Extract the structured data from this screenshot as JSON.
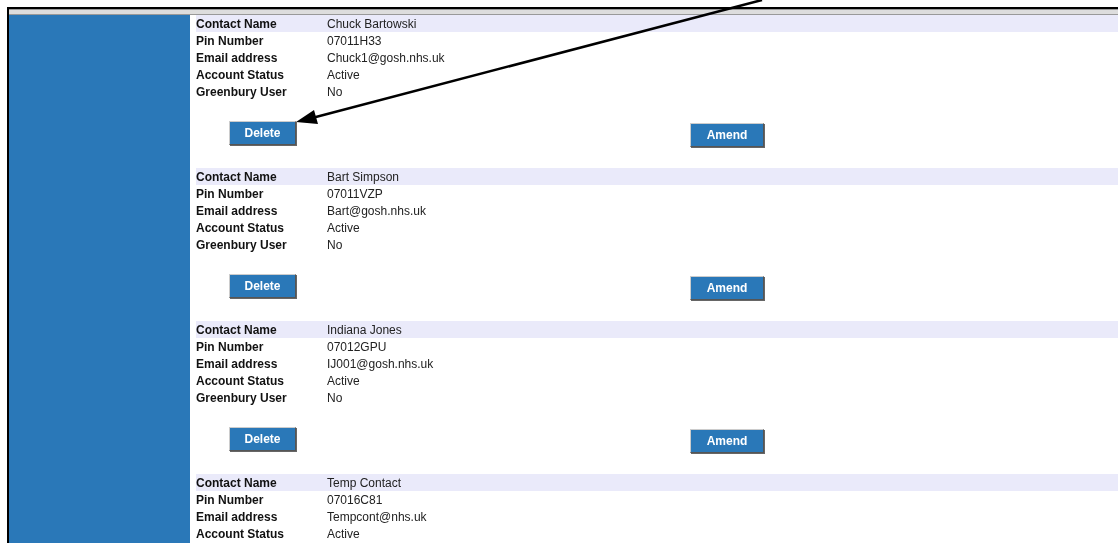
{
  "contacts": [
    {
      "fields": [
        {
          "label": "Contact Name",
          "value": "Chuck Bartowski"
        },
        {
          "label": "Pin Number",
          "value": "07011H33"
        },
        {
          "label": "Email address",
          "value": "Chuck1@gosh.nhs.uk"
        },
        {
          "label": "Account Status",
          "value": "Active"
        },
        {
          "label": "Greenbury User",
          "value": "No"
        }
      ],
      "buttons": [
        {
          "kind": "delete",
          "label": "Delete"
        },
        {
          "kind": "amend",
          "label": "Amend"
        }
      ]
    },
    {
      "fields": [
        {
          "label": "Contact Name",
          "value": "Bart Simpson"
        },
        {
          "label": "Pin Number",
          "value": "07011VZP"
        },
        {
          "label": "Email address",
          "value": "Bart@gosh.nhs.uk"
        },
        {
          "label": "Account Status",
          "value": "Active"
        },
        {
          "label": "Greenbury User",
          "value": "No"
        }
      ],
      "buttons": [
        {
          "kind": "delete",
          "label": "Delete"
        },
        {
          "kind": "amend",
          "label": "Amend"
        }
      ]
    },
    {
      "fields": [
        {
          "label": "Contact Name",
          "value": "Indiana Jones"
        },
        {
          "label": "Pin Number",
          "value": "07012GPU"
        },
        {
          "label": "Email address",
          "value": "IJ001@gosh.nhs.uk"
        },
        {
          "label": "Account Status",
          "value": "Active"
        },
        {
          "label": "Greenbury User",
          "value": "No"
        }
      ],
      "buttons": [
        {
          "kind": "delete",
          "label": "Delete"
        },
        {
          "kind": "amend",
          "label": "Amend"
        }
      ]
    },
    {
      "fields": [
        {
          "label": "Contact Name",
          "value": "Temp Contact"
        },
        {
          "label": "Pin Number",
          "value": "07016C81"
        },
        {
          "label": "Email address",
          "value": "Tempcont@nhs.uk"
        },
        {
          "label": "Account Status",
          "value": "Active"
        }
      ]
    }
  ]
}
